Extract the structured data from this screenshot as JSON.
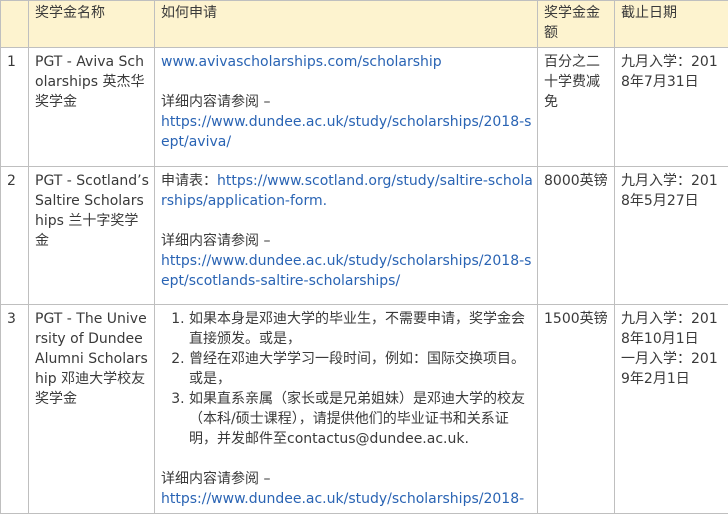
{
  "table": {
    "headers": [
      "",
      "奖学金名称",
      "如何申请",
      "奖学金金额",
      "截止日期"
    ],
    "rows": [
      {
        "num": "1",
        "name": "PGT - Aviva Scholarships 英杰华奖学金",
        "apply_link": "www.avivascholarships.com/scholarship",
        "detail_label": "详细内容请参阅 –",
        "detail_url": "https://www.dundee.ac.uk/study/scholarships/2018-sept/aviva/",
        "amount": "百分之二十学费减免",
        "deadline": "九月入学：2018年7月31日"
      },
      {
        "num": "2",
        "name": "PGT - Scotland’s Saltire Scholarships 兰十字奖学金",
        "form_label": "申请表：",
        "form_url": "https://www.scotland.org/study/saltire-scholarships/application-form.",
        "detail_label": "详细内容请参阅 –",
        "detail_url": "https://www.dundee.ac.uk/study/scholarships/2018-sept/scotlands-saltire-scholarships/",
        "amount": "8000英镑",
        "deadline": "九月入学：2018年5月27日"
      },
      {
        "num": "3",
        "name": "PGT - The University of Dundee Alumni Scholarship 邓迪大学校友奖学金",
        "steps": [
          "如果本身是邓迪大学的毕业生，不需要申请，奖学金会直接颁发。或是，",
          "曾经在邓迪大学学习一段时间，例如：国际交换项目。或是，",
          "如果直系亲属（家长或是兄弟姐妹）是邓迪大学的校友（本科/硕士课程），请提供他们的毕业证书和关系证明，并发邮件至contactus@dundee.ac.uk."
        ],
        "detail_label": "详细内容请参阅 –",
        "detail_url": "https://www.dundee.ac.uk/study/scholarships/2018-",
        "amount": "1500英镑",
        "deadline_1": "九月入学：2018年10月1日",
        "deadline_2": "一月入学：2019年2月1日"
      }
    ]
  }
}
